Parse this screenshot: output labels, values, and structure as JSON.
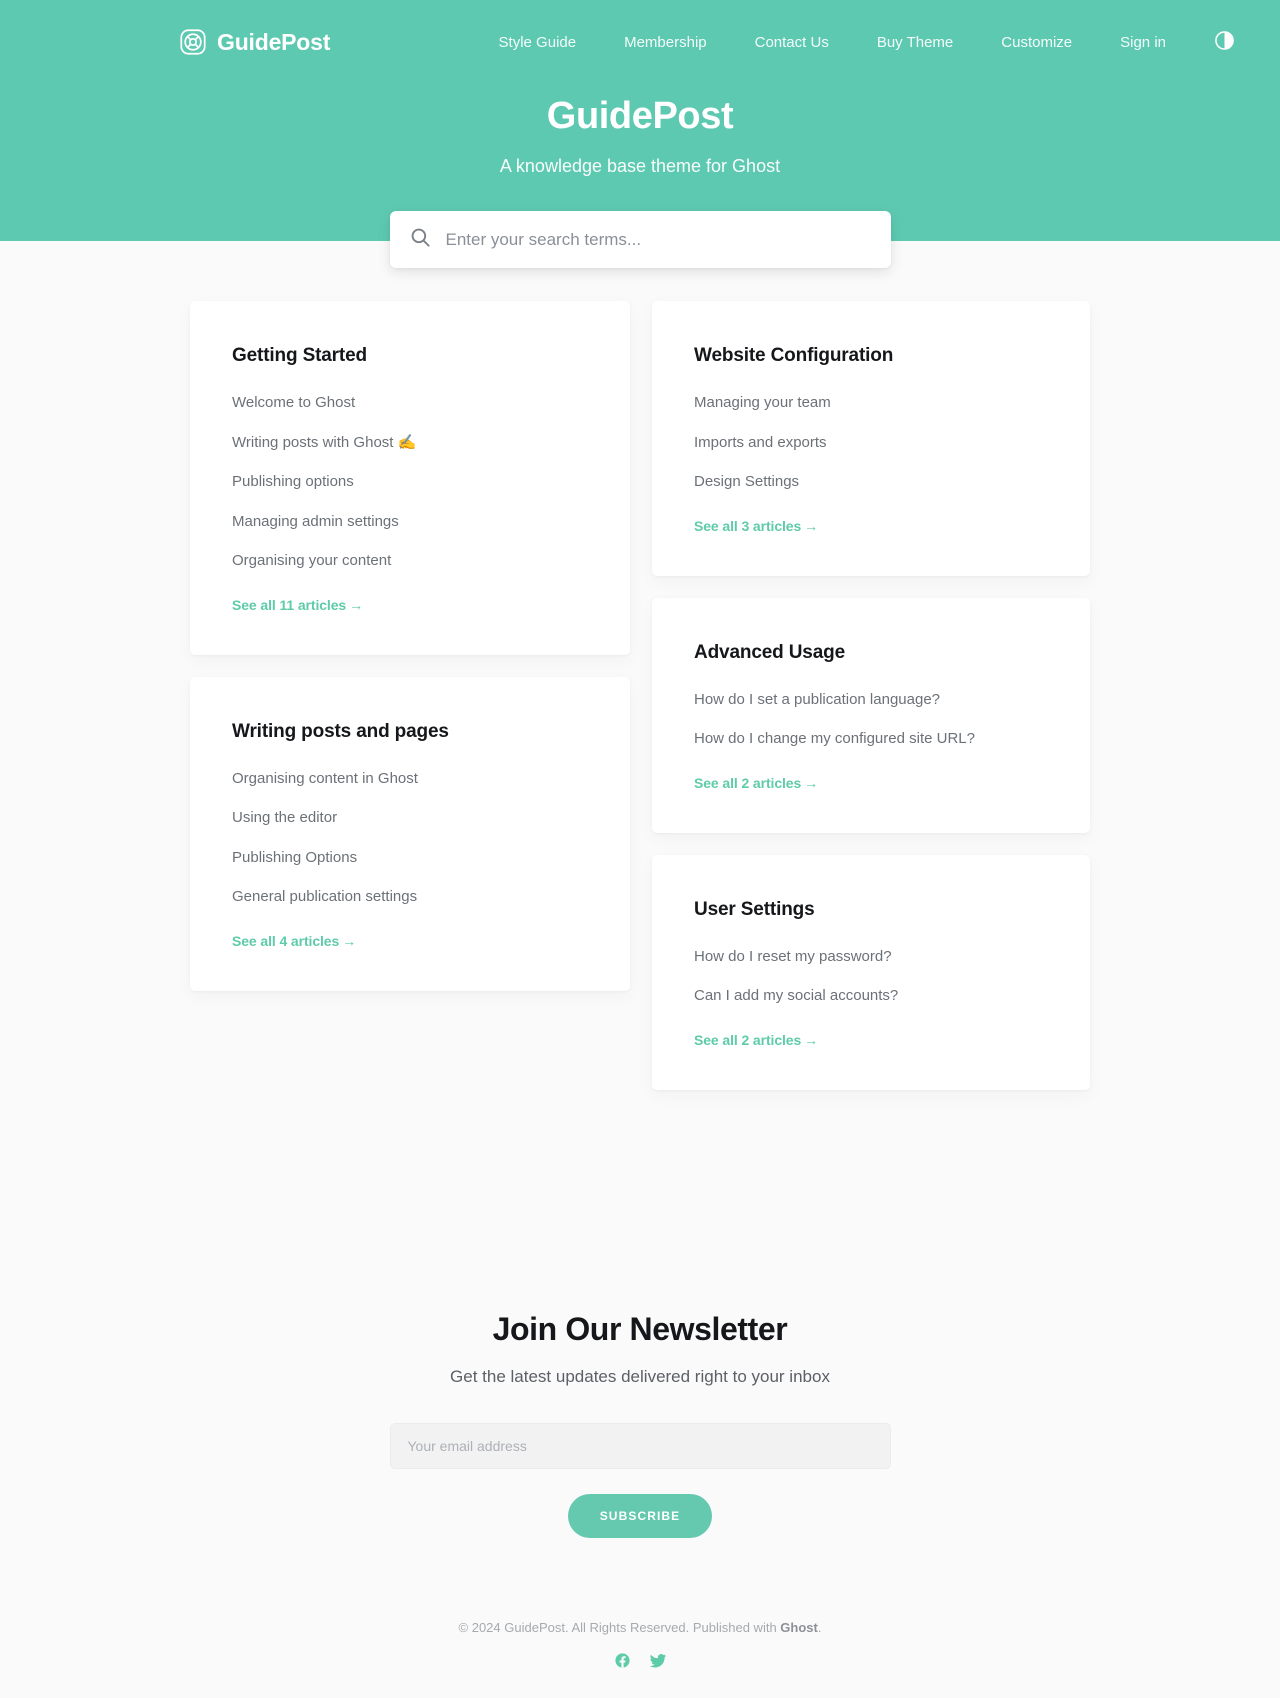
{
  "site": {
    "brand_name": "GuidePost",
    "logo_icon": "lifebuoy-icon"
  },
  "nav": {
    "items": [
      {
        "label": "Style Guide"
      },
      {
        "label": "Membership"
      },
      {
        "label": "Contact Us"
      },
      {
        "label": "Buy Theme"
      },
      {
        "label": "Customize"
      },
      {
        "label": "Sign in"
      }
    ],
    "mode_toggle_icon": "half-circle-dark-mode-icon"
  },
  "hero": {
    "title": "GuidePost",
    "subtitle": "A knowledge base theme for Ghost",
    "bg_color": "#5ec9b1"
  },
  "search": {
    "icon": "search-icon",
    "placeholder": "Enter your search terms...",
    "value": ""
  },
  "cards": {
    "left": [
      {
        "title": "Getting Started",
        "links": [
          "Welcome to Ghost",
          "Writing posts with Ghost ✍️",
          "Publishing options",
          "Managing admin settings",
          "Organising your content"
        ],
        "see_all": "See all 11 articles",
        "arrow": "→"
      },
      {
        "title": "Writing posts and pages",
        "links": [
          "Organising content in Ghost",
          "Using the editor",
          "Publishing Options",
          "General publication settings"
        ],
        "see_all": "See all 4 articles",
        "arrow": "→"
      }
    ],
    "right": [
      {
        "title": "Website Configuration",
        "links": [
          "Managing your team",
          "Imports and exports",
          "Design Settings"
        ],
        "see_all": "See all 3 articles",
        "arrow": "→"
      },
      {
        "title": "Advanced Usage",
        "links": [
          "How do I set a publication language?",
          "How do I change my configured site URL?"
        ],
        "see_all": "See all 2 articles",
        "arrow": "→"
      },
      {
        "title": "User Settings",
        "links": [
          "How do I reset my password?",
          "Can I add my social accounts?"
        ],
        "see_all": "See all 2 articles",
        "arrow": "→"
      }
    ]
  },
  "newsletter": {
    "title": "Join Our Newsletter",
    "subtitle": "Get the latest updates delivered right to your inbox",
    "email_placeholder": "Your email address",
    "email_value": "",
    "subscribe_label": "SUBSCRIBE",
    "accent_color": "#64c9ae"
  },
  "footer": {
    "copyright_prefix": "© 2024 GuidePost. All Rights Reserved. Published with ",
    "ghost_label": "Ghost",
    "copyright_suffix": ".",
    "social": [
      {
        "name": "facebook-icon"
      },
      {
        "name": "twitter-icon"
      }
    ],
    "social_color": "#5ecba9"
  }
}
